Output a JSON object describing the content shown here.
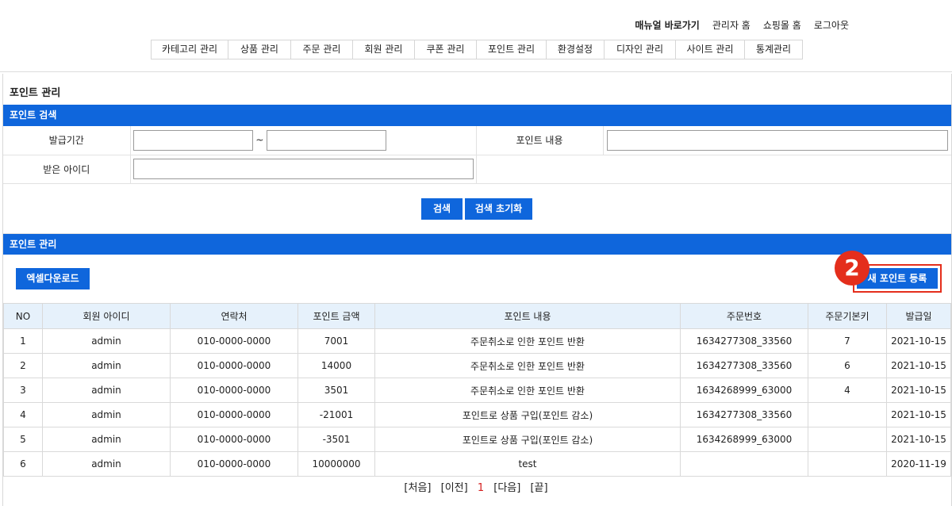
{
  "top_links": {
    "manual": "매뉴얼 바로가기",
    "admin_home": "관리자 홈",
    "shop_home": "쇼핑몰 홈",
    "logout": "로그아웃"
  },
  "nav": [
    "카테고리 관리",
    "상품 관리",
    "주문 관리",
    "회원 관리",
    "쿠폰 관리",
    "포인트 관리",
    "환경설정",
    "디자인 관리",
    "사이트 관리",
    "통계관리"
  ],
  "page_title": "포인트 관리",
  "search_section": {
    "title": "포인트 검색",
    "issue_period_label": "발급기간",
    "tilde": "~",
    "content_label": "포인트 내용",
    "recipient_label": "받은 아이디",
    "search_button": "검색",
    "reset_button": "검색 초기화"
  },
  "manage_section": {
    "title": "포인트 관리",
    "excel_button": "엑셀다운로드",
    "new_button": "새 포인트 등록",
    "callout_number": "2"
  },
  "table": {
    "headers": [
      "NO",
      "회원 아이디",
      "연락처",
      "포인트 금액",
      "포인트 내용",
      "주문번호",
      "주문기본키",
      "발급일"
    ],
    "rows": [
      [
        "1",
        "admin",
        "010-0000-0000",
        "7001",
        "주문취소로 인한 포인트 반환",
        "1634277308_33560",
        "7",
        "2021-10-15"
      ],
      [
        "2",
        "admin",
        "010-0000-0000",
        "14000",
        "주문취소로 인한 포인트 반환",
        "1634277308_33560",
        "6",
        "2021-10-15"
      ],
      [
        "3",
        "admin",
        "010-0000-0000",
        "3501",
        "주문취소로 인한 포인트 반환",
        "1634268999_63000",
        "4",
        "2021-10-15"
      ],
      [
        "4",
        "admin",
        "010-0000-0000",
        "-21001",
        "포인트로 상품 구입(포인트 감소)",
        "1634277308_33560",
        "",
        "2021-10-15"
      ],
      [
        "5",
        "admin",
        "010-0000-0000",
        "-3501",
        "포인트로 상품 구입(포인트 감소)",
        "1634268999_63000",
        "",
        "2021-10-15"
      ],
      [
        "6",
        "admin",
        "010-0000-0000",
        "10000000",
        "test",
        "",
        "",
        "2020-11-19"
      ]
    ]
  },
  "pager": {
    "first": "[처음]",
    "prev": "[이전]",
    "current": "1",
    "next": "[다음]",
    "last": "[끝]"
  },
  "colors": {
    "primary": "#0f66dc",
    "callout": "#e42e1c",
    "header_bg": "#e6f1fb"
  }
}
